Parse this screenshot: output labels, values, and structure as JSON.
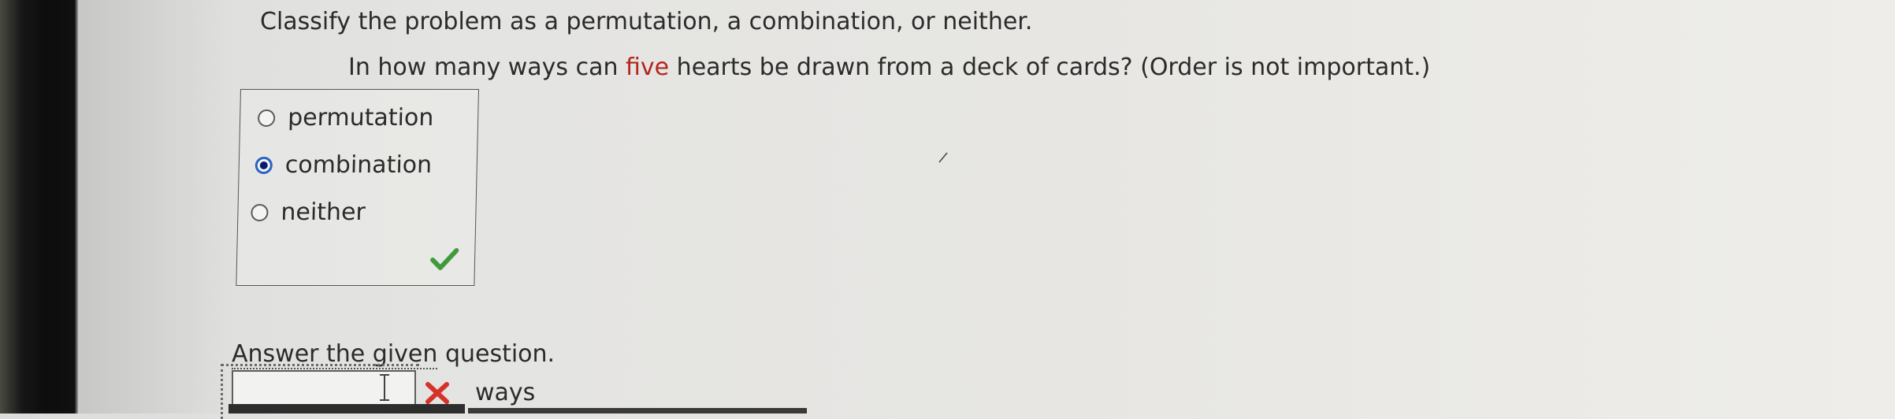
{
  "instruction": "Classify the problem as a permutation, a combination, or neither.",
  "question": {
    "before": "In how many ways can ",
    "highlight": "five",
    "after": " hearts be drawn from a deck of cards? (Order is not important.)"
  },
  "choices": [
    {
      "label": "permutation",
      "selected": false
    },
    {
      "label": "combination",
      "selected": true
    },
    {
      "label": "neither",
      "selected": false
    }
  ],
  "choice_status_icon": "checkmark-icon",
  "answer": {
    "prompt_underlined": "Answer the given",
    "prompt_rest": " question.",
    "input_value": "",
    "status_icon": "x-icon",
    "unit": "ways"
  },
  "colors": {
    "highlight": "#b3261e",
    "radio_selected": "#2764c4",
    "check": "#3f9b3a",
    "error": "#d6322a"
  }
}
